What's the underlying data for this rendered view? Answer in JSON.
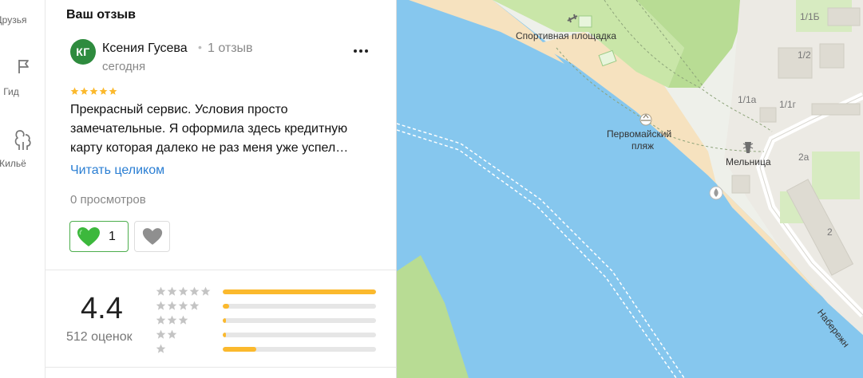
{
  "nav": {
    "friends_label": "Друзья",
    "guide_label": "Гид",
    "housing_label": "Жильё"
  },
  "review_section": {
    "title": "Ваш отзыв",
    "author": {
      "initials": "КГ",
      "name": "Ксения Гусева",
      "review_count": "1 отзыв",
      "avatar_color": "#2e8b3e"
    },
    "date": "сегодня",
    "stars": 5,
    "text": "Прекрасный сервис. Условия просто замечательные. Я оформила здесь кредитную карту которая далеко не раз меня уже успел…",
    "read_more": "Читать целиком",
    "views": "0 просмотров",
    "likes": "1"
  },
  "rating_summary": {
    "average": "4.4",
    "count_label": "512 оценок",
    "distribution": [
      {
        "stars": 5,
        "fraction": 1.0
      },
      {
        "stars": 4,
        "fraction": 0.04
      },
      {
        "stars": 3,
        "fraction": 0.02
      },
      {
        "stars": 2,
        "fraction": 0.02
      },
      {
        "stars": 1,
        "fraction": 0.22
      }
    ],
    "bar_color": "#fbb92d"
  },
  "map": {
    "labels": {
      "sports_ground": "Спортивная площадка",
      "beach_line1": "Первомайский",
      "beach_line2": "пляж",
      "mill": "Мельница",
      "b_1_1b": "1/1Б",
      "b_1_2": "1/2",
      "b_1_1a": "1/1а",
      "b_1_1g": "1/1г",
      "b_2a": "2а",
      "b_2": "2",
      "street": "Набережн"
    },
    "water_color": "#86c7ee",
    "sand_color": "#f6e2bf",
    "green_color": "#c9e6a8"
  }
}
